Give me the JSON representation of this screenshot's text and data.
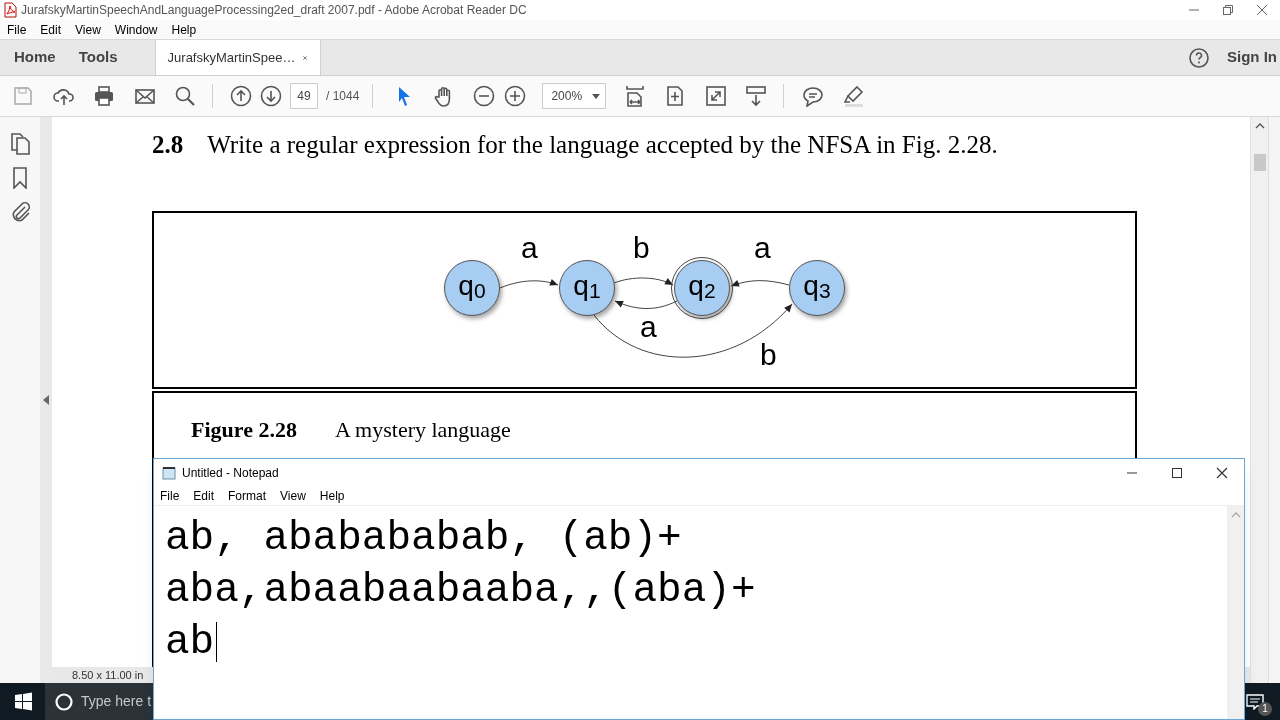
{
  "app_window": {
    "title": "JurafskyMartinSpeechAndLanguageProcessing2ed_draft 2007.pdf - Adobe Acrobat Reader DC"
  },
  "menu": [
    "File",
    "Edit",
    "View",
    "Window",
    "Help"
  ],
  "tabs": [
    {
      "label": "Home",
      "selected": false
    },
    {
      "label": "Tools",
      "selected": false
    },
    {
      "label": "JurafskyMartinSpee…",
      "selected": true
    }
  ],
  "sign_in": "Sign In",
  "toolbar": {
    "page_number": "49",
    "page_total": "/ 1044",
    "zoom": "200%"
  },
  "document": {
    "exercise_number": "2.8",
    "exercise_text": "Write a regular expression for the language accepted by the NFSA in Fig. 2.28.",
    "figure": {
      "states": [
        {
          "label": "q$_{0}$",
          "accepting": false
        },
        {
          "label": "q$_{1}$",
          "accepting": false
        },
        {
          "label": "q$_{2}$",
          "accepting": true
        },
        {
          "label": "q$_{3}$",
          "accepting": false
        }
      ],
      "edges": [
        {
          "label": "a"
        },
        {
          "label": "b"
        },
        {
          "label": "a"
        },
        {
          "label": "a"
        },
        {
          "label": "b"
        }
      ],
      "caption_label": "Figure 2.28",
      "caption_text": "A mystery language"
    }
  },
  "page_size": "8.50 x 11.00 in",
  "notepad": {
    "title": "Untitled - Notepad",
    "menu": [
      "File",
      "Edit",
      "Format",
      "View",
      "Help"
    ],
    "lines": [
      "ab, ababababab, (ab)+",
      "aba,abaabaabaaba,,(aba)+",
      "ab"
    ]
  },
  "taskbar": {
    "search_placeholder": "Type here t",
    "notification_count": "1"
  }
}
